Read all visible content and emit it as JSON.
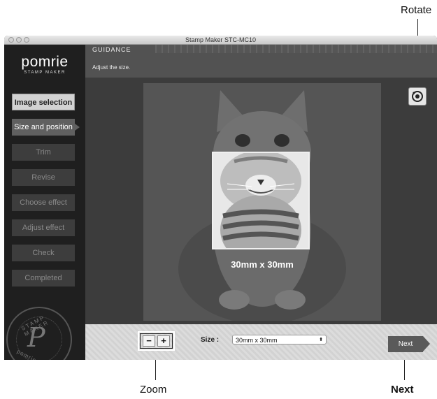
{
  "callouts": {
    "rotate": "Rotate",
    "zoom": "Zoom",
    "next": "Next"
  },
  "window": {
    "title": "Stamp Maker STC-MC10"
  },
  "logo": {
    "name": "pomrie",
    "sub": "STAMP MAKER"
  },
  "steps": [
    {
      "label": "Image selection",
      "state": "done"
    },
    {
      "label": "Size and position",
      "state": "current"
    },
    {
      "label": "Trim",
      "state": "pending"
    },
    {
      "label": "Revise",
      "state": "pending"
    },
    {
      "label": "Choose effect",
      "state": "pending"
    },
    {
      "label": "Adjust effect",
      "state": "pending"
    },
    {
      "label": "Check",
      "state": "pending"
    },
    {
      "label": "Completed",
      "state": "pending"
    }
  ],
  "seal": {
    "top": "STAMP MAKER",
    "letter": "P",
    "bottom": "pomrie"
  },
  "guidance": {
    "title": "GUIDANCE",
    "text": "Adjust the size."
  },
  "canvas": {
    "size_label": "30mm x 30mm"
  },
  "bottom": {
    "zoom_out": "−",
    "zoom_in": "+",
    "size_caption": "Size :",
    "size_value": "30mm x 30mm",
    "next": "Next"
  },
  "icons": {
    "rotate": "rotate-icon",
    "select_arrow": "up-down-arrow-icon"
  }
}
